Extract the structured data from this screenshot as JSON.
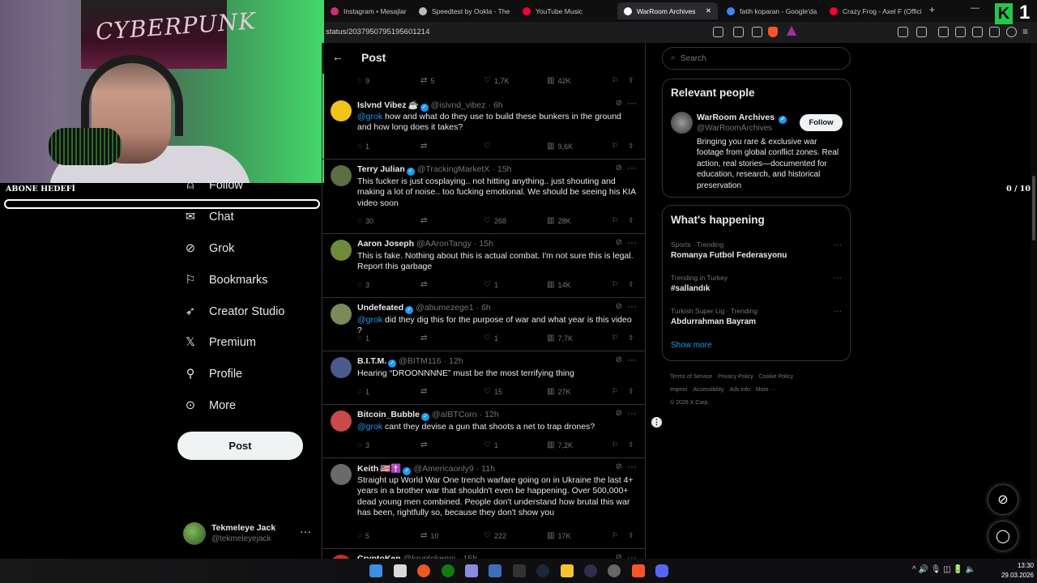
{
  "browser": {
    "tabs": [
      {
        "title": "Instagram • Mesajlar",
        "color": "#d62976",
        "active": false
      },
      {
        "title": "Speedtest by Ookla - The",
        "color": "#bbbbbb",
        "active": false
      },
      {
        "title": "YouTube Music",
        "color": "#ff0033",
        "active": false
      },
      {
        "title": "WarRoom Archives",
        "color": "#ffffff",
        "active": true
      },
      {
        "title": "fatih koparan - Google'da",
        "color": "#4285f4",
        "active": false
      },
      {
        "title": "Crazy Frog - Axel F (Offici",
        "color": "#ff0033",
        "active": false
      }
    ],
    "new_tab": "+",
    "url": "status/2037950795195601214"
  },
  "stream_overlay": {
    "poster_text": "CYBERPUNK",
    "goal_label": "ABONE HEDEFİ",
    "goal_count": "0 / 10",
    "goal_progress": 0.0,
    "k_logo": "K",
    "k_number": "1"
  },
  "nav": {
    "items": [
      {
        "label": "Follow",
        "icon": "person-plus-icon"
      },
      {
        "label": "Chat",
        "icon": "mail-icon"
      },
      {
        "label": "Grok",
        "icon": "grok-icon"
      },
      {
        "label": "Bookmarks",
        "icon": "bookmark-icon"
      },
      {
        "label": "Creator Studio",
        "icon": "rocket-icon"
      },
      {
        "label": "Premium",
        "icon": "x-logo-icon"
      },
      {
        "label": "Profile",
        "icon": "person-icon"
      },
      {
        "label": "More",
        "icon": "more-circle-icon"
      }
    ],
    "post_button": "Post"
  },
  "account": {
    "name": "Tekmeleye Jack",
    "handle": "@tekmeleyejack",
    "more": "···"
  },
  "post_header": {
    "title": "Post"
  },
  "top_actions": {
    "replies": "9",
    "reposts": "5",
    "likes": "1,7K",
    "views": "42K"
  },
  "replies": [
    {
      "name": "Islvnd Vibez",
      "name_emoji": "☕",
      "verified": true,
      "handle": "@islvnd_vibez",
      "time": "6h",
      "mention": "@grok",
      "text": "how and what do they use to build these bunkers in the ground and how long does it takes?",
      "avatar_color": "#f2c21b",
      "replies": "1",
      "reposts": "",
      "likes": "",
      "views": "9,6K"
    },
    {
      "name": "Terry Julian",
      "name_emoji": "",
      "verified": true,
      "handle": "@TrackingMarketX",
      "time": "15h",
      "mention": "",
      "text": "This fucker is just cosplaying.. not hitting anything.. just shouting and making a lot of noise.. too fucking emotional. We should be seeing his KIA video soon",
      "avatar_color": "#5b6e44",
      "replies": "30",
      "reposts": "",
      "likes": "268",
      "views": "28K"
    },
    {
      "name": "Aaron Joseph",
      "name_emoji": "",
      "verified": false,
      "handle": "@AAronTangy",
      "time": "15h",
      "mention": "",
      "text": "This is fake. Nothing about this is actual combat. I'm not sure this is legal. Report this garbage",
      "avatar_color": "#6f8a3c",
      "replies": "3",
      "reposts": "",
      "likes": "1",
      "views": "14K"
    },
    {
      "name": "Undefeated",
      "name_emoji": "",
      "verified": true,
      "handle": "@abumezege1",
      "time": "6h",
      "mention": "@grok",
      "text": "did they dig this for the purpose of war and what year is this video ?",
      "avatar_color": "#7a8a5a",
      "replies": "1",
      "reposts": "",
      "likes": "1",
      "views": "7,7K"
    },
    {
      "name": "B.I.T.M.",
      "name_emoji": "",
      "verified": true,
      "handle": "@BITM116",
      "time": "12h",
      "mention": "",
      "text": "Hearing “DROONNNNE” must be the most terrifying thing",
      "avatar_color": "#4a5a8a",
      "replies": "1",
      "reposts": "",
      "likes": "15",
      "views": "27K"
    },
    {
      "name": "Bitcoin_Bubble",
      "name_emoji": "",
      "verified": true,
      "handle": "@aIBTCorn",
      "time": "12h",
      "mention": "@grok",
      "text": "cant they devise a gun that shoots a net to trap drones?",
      "avatar_color": "#c84a4a",
      "replies": "3",
      "reposts": "",
      "likes": "1",
      "views": "7,2K"
    },
    {
      "name": "Keith",
      "name_emoji": "🇺🇸✝️",
      "verified": true,
      "handle": "@Americaonly9",
      "time": "11h",
      "mention": "",
      "text": "Straight up World War One trench warfare going on in Ukraine the last 4+ years in a brother war that shouldn't even be happening. Over 500,000+ dead young men combined. People don't understand how brutal this war has been, rightfully so, because they don't show you",
      "avatar_color": "#6a6a6a",
      "replies": "5",
      "reposts": "10",
      "likes": "222",
      "views": "17K"
    },
    {
      "name": "CryptoKen",
      "name_emoji": "",
      "verified": false,
      "handle": "@kryptokenni",
      "time": "15h",
      "mention": "",
      "text": "",
      "avatar_color": "#c0302a",
      "replies": "",
      "reposts": "",
      "likes": "",
      "views": ""
    }
  ],
  "search": {
    "placeholder": "Search"
  },
  "relevant_people": {
    "title": "Relevant people",
    "name": "WarRoom Archives",
    "handle": "@WarRoomArchives",
    "follow_label": "Follow",
    "bio": "Bringing you rare & exclusive war footage from global conflict zones. Real action, real stories—documented for education, research, and historical preservation"
  },
  "whats_happening": {
    "title": "What's happening",
    "trends": [
      {
        "context": "Sports · Trending",
        "title": "Romanya Futbol Federasyonu"
      },
      {
        "context": "Trending in Turkey",
        "title": "#sallandık"
      },
      {
        "context": "Turkish Super Lig · Trending",
        "title": "Abdurrahman Bayram"
      }
    ],
    "show_more": "Show more"
  },
  "footer_links": [
    "Terms of Service",
    "Privacy Policy",
    "Cookie Policy",
    "Imprint",
    "Accessibility",
    "Ads info",
    "More ···",
    "© 2026 X Corp."
  ],
  "taskbar": {
    "time": "13:30",
    "date": "29.03.2026"
  }
}
